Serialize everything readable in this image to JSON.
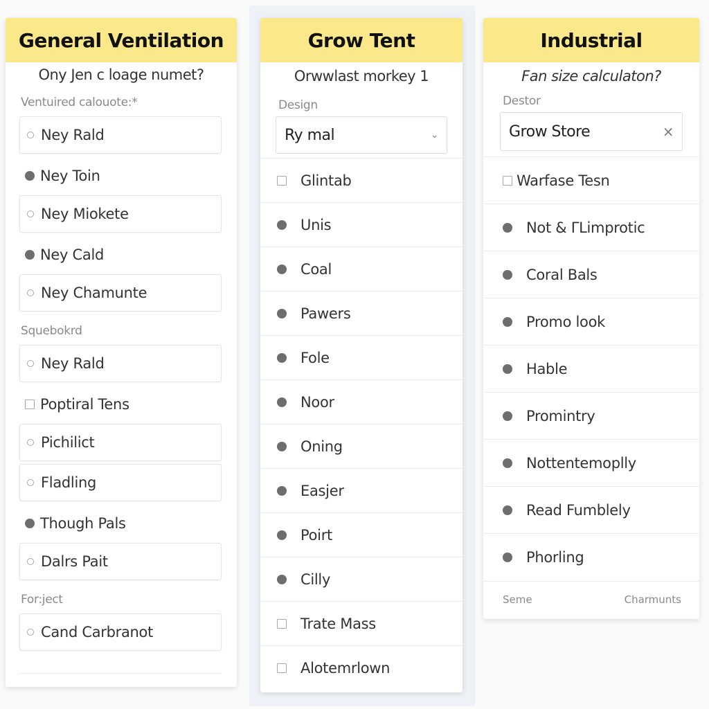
{
  "panels": {
    "general": {
      "title": "General Ventilation",
      "subtitle": "Ony Jen c loage numet?",
      "section1_label": "Ventuired calouote:*",
      "section1_items": [
        {
          "label": "Ney Rald",
          "icon": "radio-empty",
          "boxed": true
        },
        {
          "label": "Ney Toin",
          "icon": "radio-filled",
          "boxed": false
        },
        {
          "label": "Ney Miokete",
          "icon": "radio-empty",
          "boxed": true
        },
        {
          "label": "Ney Cald",
          "icon": "radio-filled",
          "boxed": false
        },
        {
          "label": "Ney Chamunte",
          "icon": "radio-empty",
          "boxed": true
        }
      ],
      "section2_label": "Squebokrd",
      "section2_items": [
        {
          "label": "Ney Rald",
          "icon": "radio-empty",
          "boxed": true
        },
        {
          "label": "Poptiral Tens",
          "icon": "checkbox-empty",
          "boxed": false
        },
        {
          "label": "Pichilict",
          "icon": "radio-empty",
          "boxed": true
        },
        {
          "label": "Fladling",
          "icon": "radio-empty",
          "boxed": true
        },
        {
          "label": "Though Pals",
          "icon": "radio-filled",
          "boxed": false
        },
        {
          "label": "Dalrs Pait",
          "icon": "radio-empty",
          "boxed": true
        }
      ],
      "section3_label": "For:ject",
      "section3_items": [
        {
          "label": "Cand Carbranot",
          "icon": "radio-empty",
          "boxed": true
        }
      ]
    },
    "grow_tent": {
      "title": "Grow Tent",
      "subtitle": "Orwwlast morkey 1",
      "design_label": "Design",
      "design_value": "Ry mal",
      "items": [
        {
          "label": "Glintab",
          "icon": "checkbox-empty"
        },
        {
          "label": "Unis",
          "icon": "radio-filled"
        },
        {
          "label": "Coal",
          "icon": "radio-filled"
        },
        {
          "label": "Pawers",
          "icon": "radio-filled"
        },
        {
          "label": "Fole",
          "icon": "radio-filled"
        },
        {
          "label": "Noor",
          "icon": "radio-filled"
        },
        {
          "label": "Oning",
          "icon": "radio-filled"
        },
        {
          "label": "Easjer",
          "icon": "radio-filled"
        },
        {
          "label": "Poirt",
          "icon": "radio-filled"
        },
        {
          "label": "Cilly",
          "icon": "radio-filled"
        },
        {
          "label": "Trate Mass",
          "icon": "checkbox-empty"
        },
        {
          "label": "Alotemrlown",
          "icon": "checkbox-empty"
        }
      ]
    },
    "industrial": {
      "title": "Industrial",
      "subtitle": "Fan size calculaton?",
      "destor_label": "Destor",
      "destor_value": "Grow Store",
      "clear_icon": "×",
      "items": [
        {
          "label": "Warfase Tesn",
          "icon": "checkbox-empty"
        },
        {
          "label": "Not & ΓLimprotic",
          "icon": "radio-filled"
        },
        {
          "label": "Coral Bals",
          "icon": "radio-filled"
        },
        {
          "label": "Promo look",
          "icon": "radio-filled"
        },
        {
          "label": "Hable",
          "icon": "radio-filled"
        },
        {
          "label": "Promintry",
          "icon": "radio-filled"
        },
        {
          "label": "Nottentemoplly",
          "icon": "radio-filled"
        },
        {
          "label": "Read Fumblely",
          "icon": "radio-filled"
        },
        {
          "label": "Phorling",
          "icon": "radio-filled"
        }
      ],
      "footer_left": "Seme",
      "footer_right": "Charmunts"
    }
  },
  "colors": {
    "header_yellow": "#fbe88a",
    "radio_filled": "#6e6e6e",
    "backdrop_blue": "#eef2f6"
  }
}
